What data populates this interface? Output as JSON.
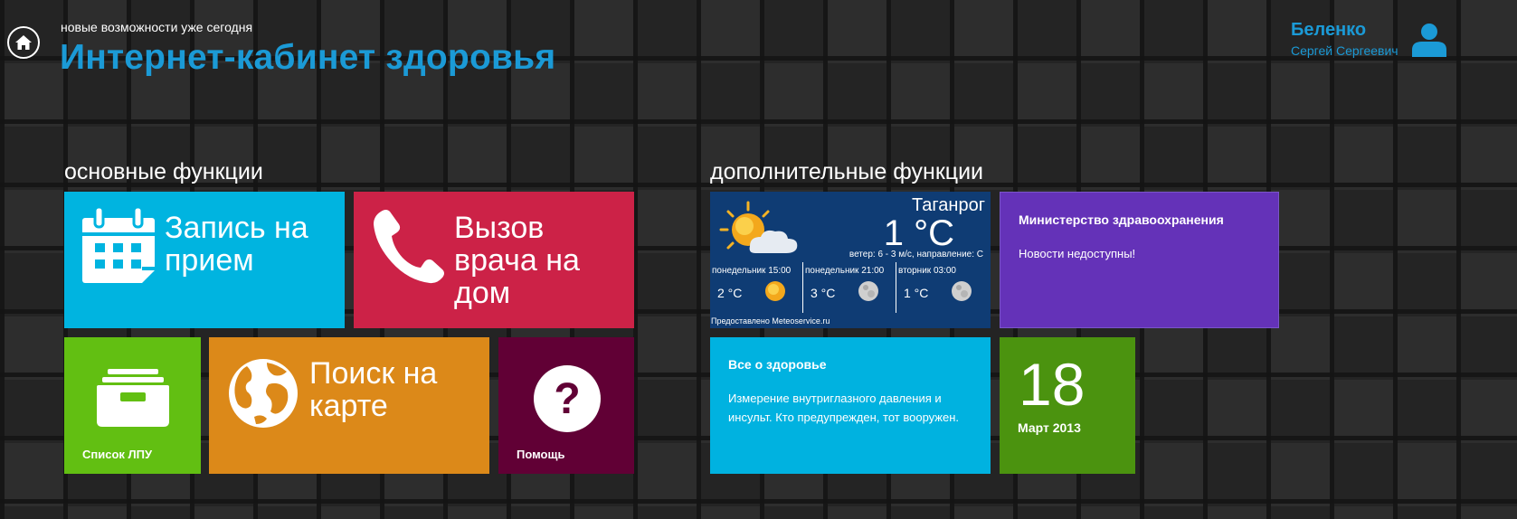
{
  "header": {
    "tagline": "новые возможности уже сегодня",
    "title": "Интернет-кабинет здоровья"
  },
  "user": {
    "last_name": "Беленко",
    "first_name": "Сергей Сергеевич",
    "icon": "user-icon"
  },
  "sections": {
    "main": "основные функции",
    "extra": "дополнительные функции"
  },
  "tiles": {
    "appointment": {
      "label": "Запись на прием",
      "line1": "Запись на",
      "line2": "прием",
      "color": "#00b4e0",
      "icon": "calendar-icon"
    },
    "home_visit": {
      "line1": "Вызов",
      "line2": "врача на",
      "line3": "дом",
      "color": "#cc2247",
      "icon": "phone-icon"
    },
    "lpu_list": {
      "label": "Список ЛПУ",
      "color": "#62bf12",
      "icon": "cabinet-icon"
    },
    "map_search": {
      "line1": "Поиск на",
      "line2": "карте",
      "color": "#dc8919",
      "icon": "globe-icon"
    },
    "help": {
      "label": "Помощь",
      "color": "#610035",
      "icon": "question-icon"
    }
  },
  "weather": {
    "city": "Таганрог",
    "temp": "1 °C",
    "wind": "ветер: 6 - 3 м/с, направление: С",
    "color": "#0f3c74",
    "forecast": [
      {
        "day": "понедельник 15:00",
        "temp": "2 °C",
        "icon": "sun-icon"
      },
      {
        "day": "понедельник 21:00",
        "temp": "3 °C",
        "icon": "moon-icon"
      },
      {
        "day": "вторник 03:00",
        "temp": "1 °C",
        "icon": "moon-icon"
      }
    ],
    "credit": "Предоставлено Meteoservice.ru"
  },
  "ministry": {
    "title": "Министерство здравоохранения",
    "text": "Новости недоступны!",
    "color": "#6432b8"
  },
  "health": {
    "title": "Все о здоровье",
    "line1": "Измерение внутриглазного давления и",
    "line2": "инсульт. Кто предупрежден, тот вооружен.",
    "color": "#00b2e0"
  },
  "date": {
    "day": "18",
    "month": "Март 2013",
    "color": "#4b930f"
  }
}
